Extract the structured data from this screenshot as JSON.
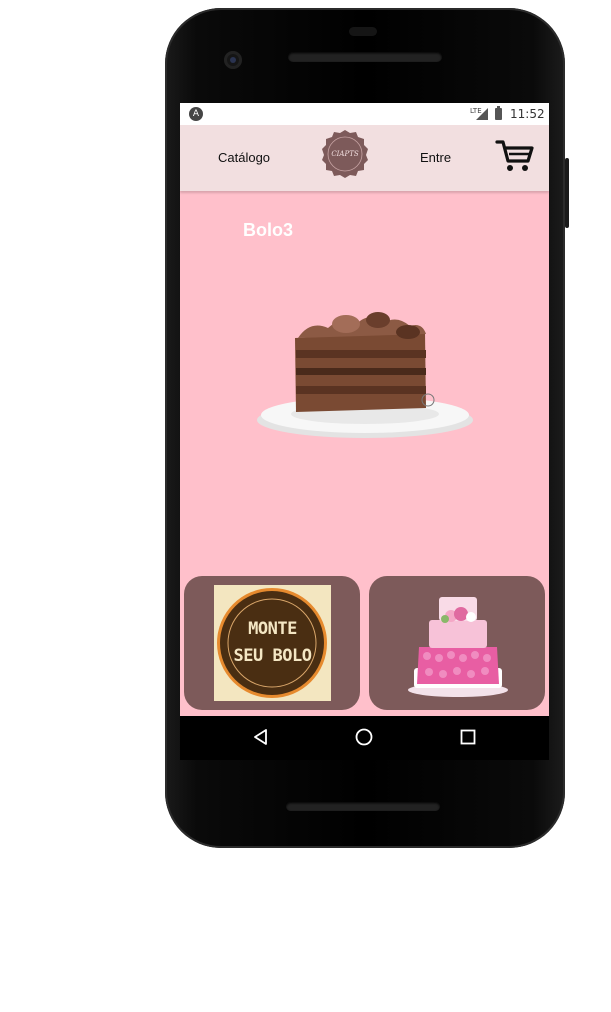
{
  "status_bar": {
    "network": "LTE",
    "time": "11:52"
  },
  "app_bar": {
    "nav_catalogo": "Catálogo",
    "nav_entre": "Entre",
    "logo_text": "CIAPTS"
  },
  "product": {
    "title": "Bolo3"
  },
  "cards": {
    "monte_line1": "MONTE",
    "monte_line2": "SEU BOLO"
  },
  "colors": {
    "screen_background": "#ffc0cb",
    "app_bar_background": "#f2dfe0",
    "card_background": "#7d5a5a"
  },
  "icons": {
    "cart": "shopping-cart-icon",
    "back": "back-triangle-icon",
    "home": "home-circle-icon",
    "recents": "recents-square-icon"
  }
}
